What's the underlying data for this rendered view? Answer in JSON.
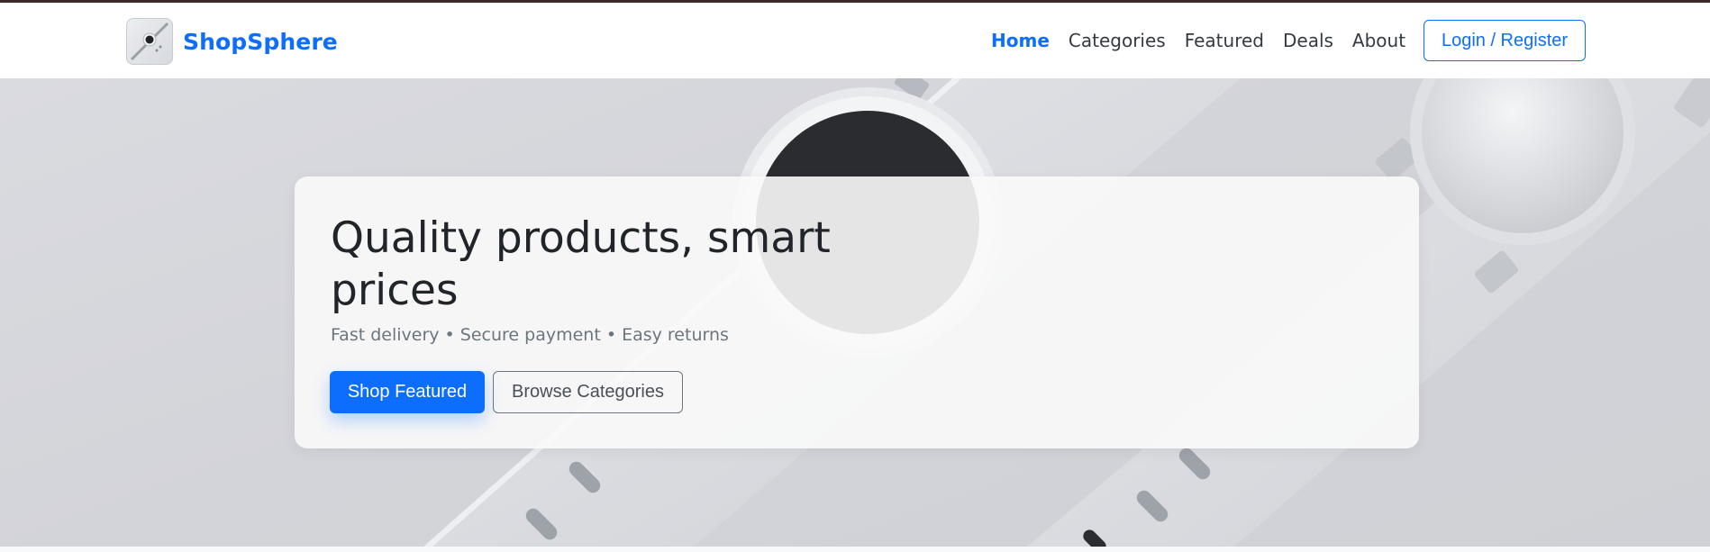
{
  "brand": {
    "name": "ShopSphere",
    "logo_icon": "watch-logo-icon"
  },
  "nav": {
    "items": [
      {
        "label": "Home",
        "active": true
      },
      {
        "label": "Categories",
        "active": false
      },
      {
        "label": "Featured",
        "active": false
      },
      {
        "label": "Deals",
        "active": false
      },
      {
        "label": "About",
        "active": false
      }
    ],
    "login_label": "Login / Register"
  },
  "hero": {
    "title": "Quality products, smart prices",
    "subtitle": "Fast delivery • Secure payment • Easy returns",
    "primary_button": "Shop Featured",
    "secondary_button": "Browse Categories",
    "background_image": "silver-smartwatch-photo"
  },
  "colors": {
    "accent": "#0d6efd",
    "text": "#212529",
    "muted": "#6c757d",
    "navbar_bg": "#ffffff",
    "top_border": "#3a2a28"
  }
}
